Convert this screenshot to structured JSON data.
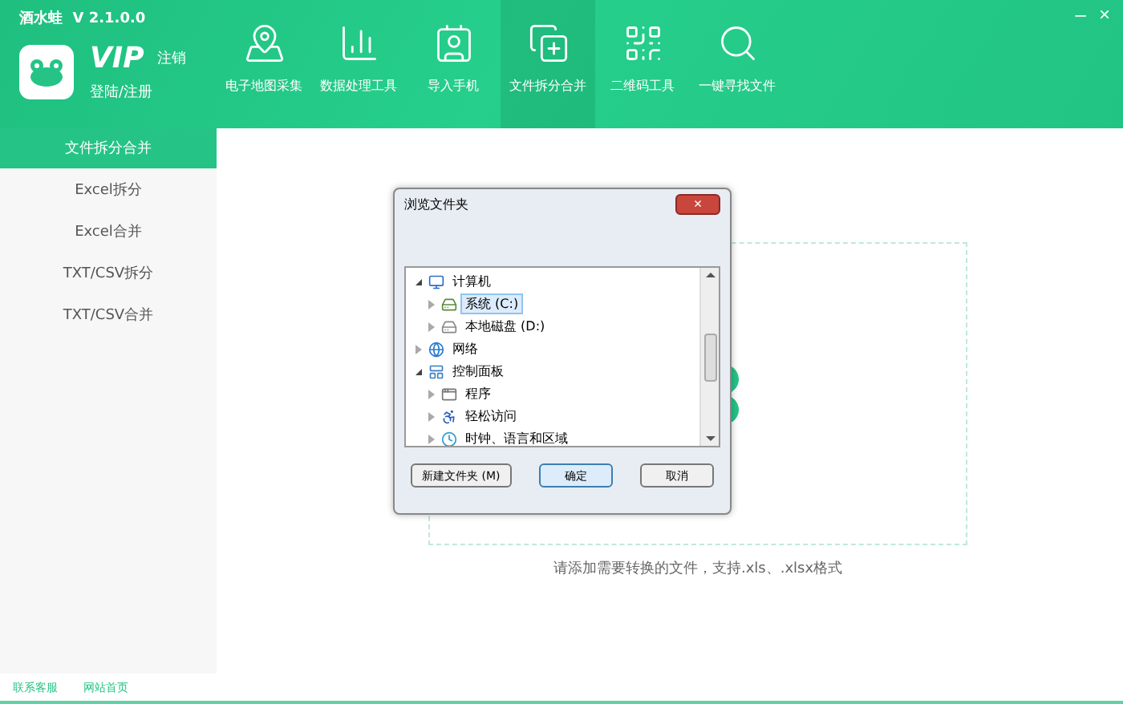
{
  "app": {
    "title": "酒水蛙  V 2.1.0.0",
    "vip": "VIP",
    "logout": "注销",
    "login": "登陆/注册"
  },
  "window_controls": [
    "–",
    "×"
  ],
  "nav": [
    {
      "label": "电子地图采集",
      "selected": false
    },
    {
      "label": "数据处理工具",
      "selected": false
    },
    {
      "label": "导入手机",
      "selected": false
    },
    {
      "label": "文件拆分合并",
      "selected": true
    },
    {
      "label": "二维码工具",
      "selected": false
    },
    {
      "label": "一键寻找文件",
      "selected": false
    }
  ],
  "sidebar": {
    "header": "文件拆分合并",
    "items": [
      {
        "label": "Excel拆分",
        "selected": false
      },
      {
        "label": "Excel合并",
        "selected": false
      },
      {
        "label": "TXT/CSV拆分",
        "selected": false
      },
      {
        "label": "TXT/CSV合并",
        "selected": false
      }
    ]
  },
  "drop_zone": {
    "hint": "请添加需要转换的文件，支持.xls、.xlsx格式"
  },
  "dialog": {
    "title": "浏览文件夹",
    "close": "×",
    "tree": [
      {
        "label": "计算机",
        "expanded": true,
        "selected": false,
        "children": [
          {
            "label": "系统 (C:)",
            "expanded": false,
            "selected": true
          },
          {
            "label": "本地磁盘 (D:)",
            "expanded": false,
            "selected": false
          }
        ]
      },
      {
        "label": "网络",
        "expanded": false,
        "selected": false
      },
      {
        "label": "控制面板",
        "expanded": true,
        "selected": false,
        "children": [
          {
            "label": "程序",
            "expanded": false,
            "selected": false
          },
          {
            "label": "轻松访问",
            "expanded": false,
            "selected": false
          },
          {
            "label": "时钟、语言和区域",
            "expanded": false,
            "selected": false
          }
        ]
      }
    ],
    "buttons": [
      {
        "label": "新建文件夹 (M)",
        "default": false
      },
      {
        "label": "确定",
        "default": true
      },
      {
        "label": "取消",
        "default": false
      }
    ]
  },
  "footer": {
    "links": [
      "联系客服",
      "网站首页"
    ]
  }
}
